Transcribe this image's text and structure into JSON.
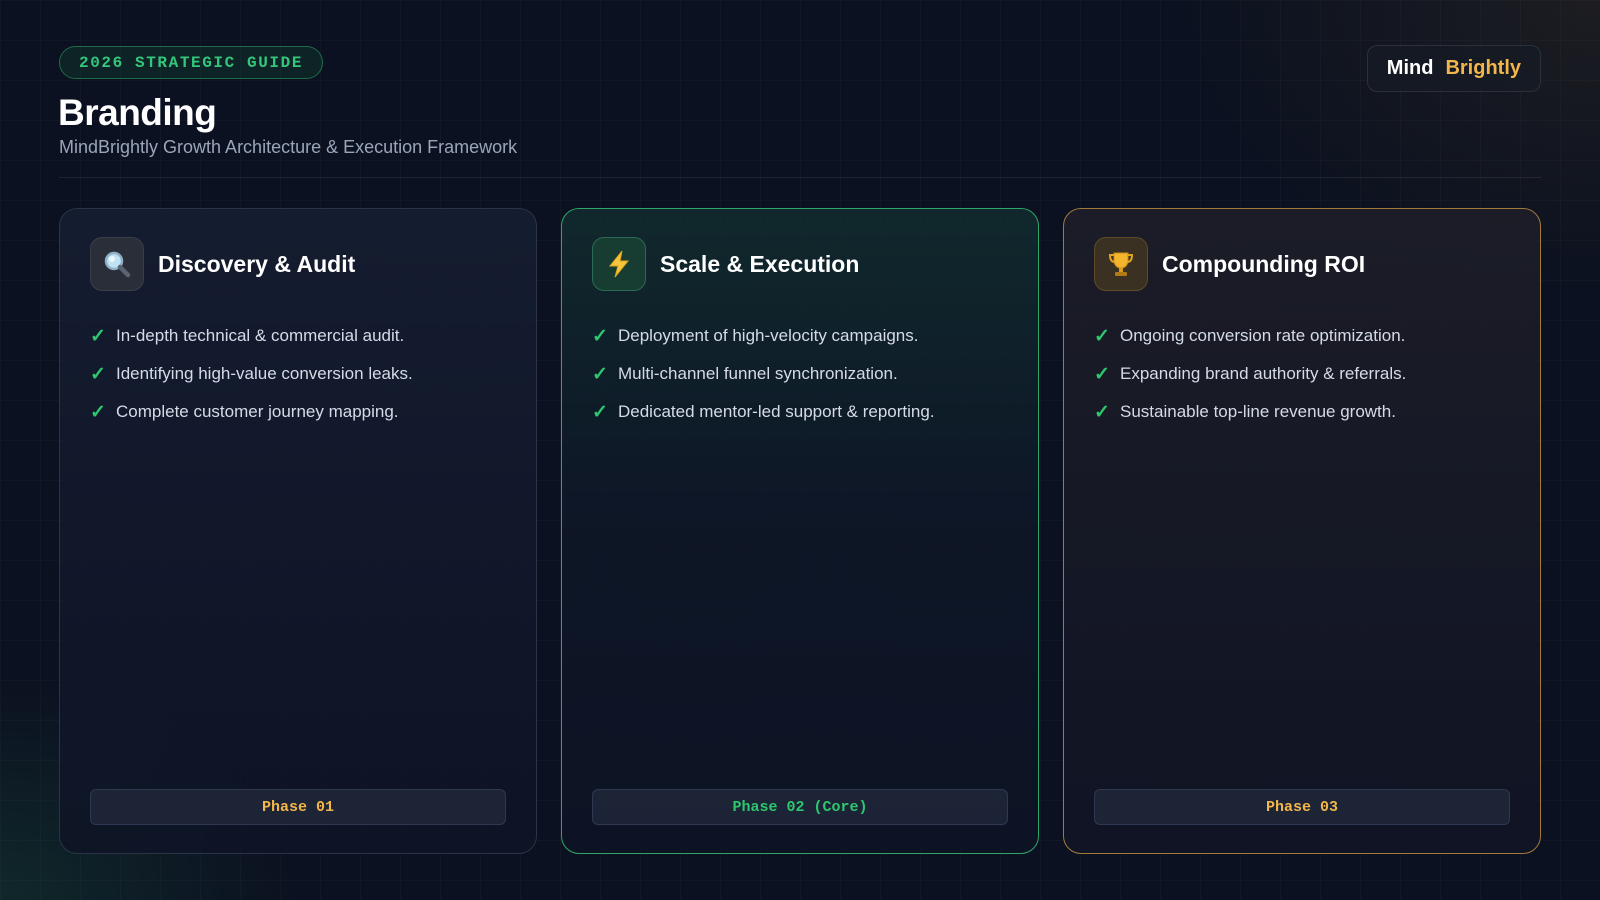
{
  "header": {
    "badge": "2026 STRATEGIC GUIDE",
    "title": "Branding",
    "subtitle": "MindBrightly Growth Architecture & Execution Framework"
  },
  "logo": {
    "part1": "Mind",
    "part2": "Brightly"
  },
  "colors": {
    "accent_green": "#2ec66f",
    "accent_gold": "#f2b64b",
    "background": "#0b1120"
  },
  "cards": [
    {
      "icon": "magnifier-icon",
      "title": "Discovery & Audit",
      "points": [
        "In-depth technical & commercial audit.",
        "Identifying high-value conversion leaks.",
        "Complete customer journey mapping."
      ],
      "phase": "Phase 01"
    },
    {
      "icon": "lightning-bolt-icon",
      "title": "Scale & Execution",
      "points": [
        "Deployment of high-velocity campaigns.",
        "Multi-channel funnel synchronization.",
        "Dedicated mentor-led support & reporting."
      ],
      "phase": "Phase 02 (Core)"
    },
    {
      "icon": "trophy-icon",
      "title": "Compounding ROI",
      "points": [
        "Ongoing conversion rate optimization.",
        "Expanding brand authority & referrals.",
        "Sustainable top-line revenue growth."
      ],
      "phase": "Phase 03"
    }
  ]
}
